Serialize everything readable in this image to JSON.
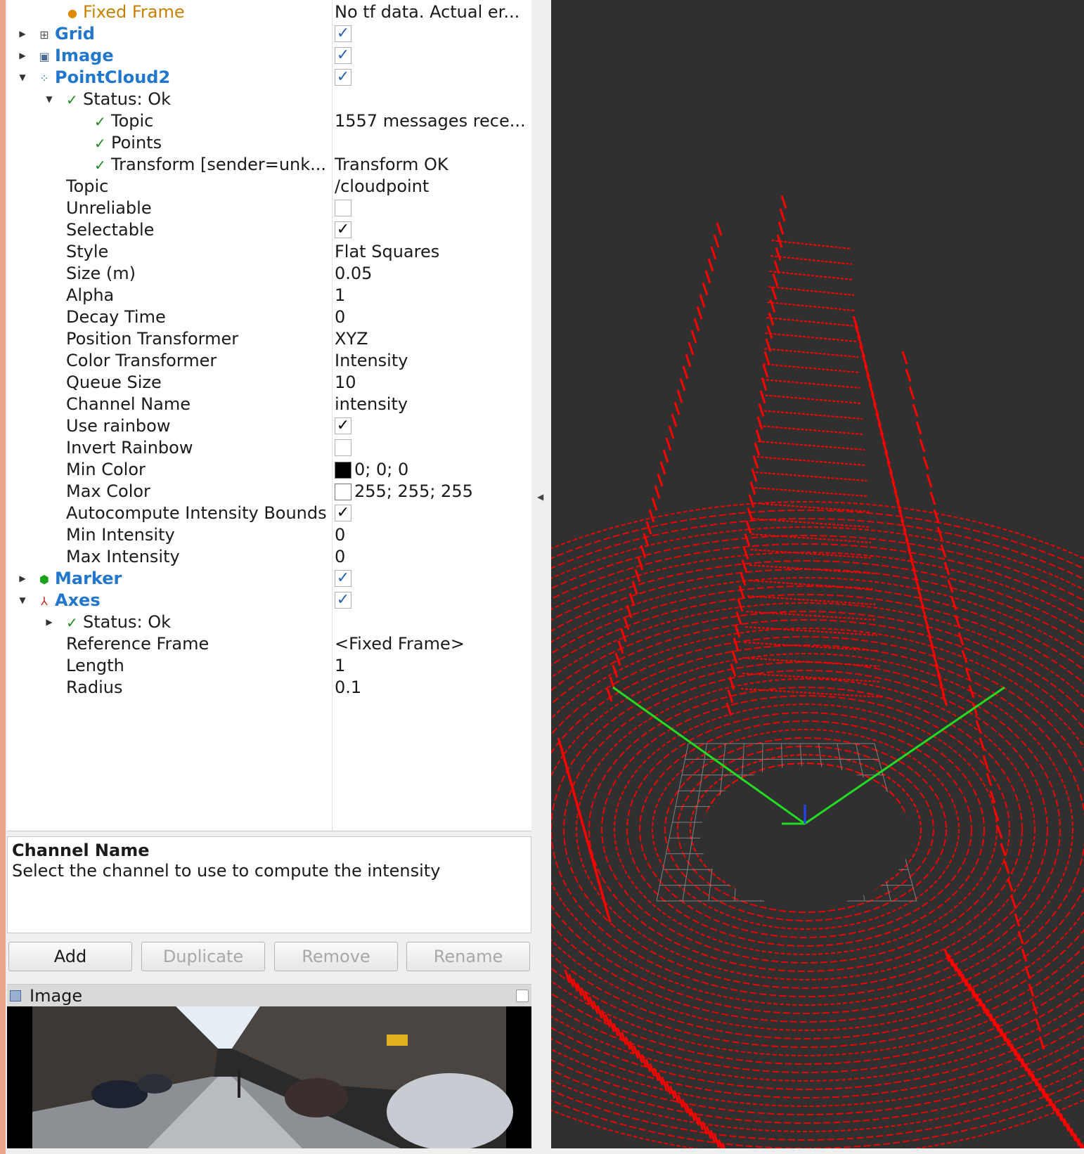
{
  "displays": {
    "fixed_frame": {
      "label": "Fixed Frame",
      "value": "No tf data.  Actual er..."
    },
    "grid": {
      "label": "Grid"
    },
    "image": {
      "label": "Image"
    },
    "pointcloud": {
      "label": "PointCloud2",
      "status": "Status: Ok",
      "status_topic": {
        "label": "Topic",
        "value": "1557 messages rece..."
      },
      "status_points": {
        "label": "Points"
      },
      "status_transform": {
        "label": "Transform [sender=unk...",
        "value": "Transform OK"
      },
      "props": [
        {
          "label": "Topic",
          "value": "/cloudpoint"
        },
        {
          "label": "Unreliable"
        },
        {
          "label": "Selectable"
        },
        {
          "label": "Style",
          "value": "Flat Squares"
        },
        {
          "label": "Size (m)",
          "value": "0.05"
        },
        {
          "label": "Alpha",
          "value": "1"
        },
        {
          "label": "Decay Time",
          "value": "0"
        },
        {
          "label": "Position Transformer",
          "value": "XYZ"
        },
        {
          "label": "Color Transformer",
          "value": "Intensity"
        },
        {
          "label": "Queue Size",
          "value": "10"
        },
        {
          "label": "Channel Name",
          "value": "intensity"
        },
        {
          "label": "Use rainbow"
        },
        {
          "label": "Invert Rainbow"
        },
        {
          "label": "Min Color",
          "value": "0; 0; 0"
        },
        {
          "label": "Max Color",
          "value": "255; 255; 255"
        },
        {
          "label": "Autocompute Intensity Bounds"
        },
        {
          "label": "Min Intensity",
          "value": "0"
        },
        {
          "label": "Max Intensity",
          "value": "0"
        }
      ]
    },
    "marker": {
      "label": "Marker"
    },
    "axes": {
      "label": "Axes",
      "status": "Status: Ok",
      "props": [
        {
          "label": "Reference Frame",
          "value": "<Fixed Frame>"
        },
        {
          "label": "Length",
          "value": "1"
        },
        {
          "label": "Radius",
          "value": "0.1"
        }
      ]
    }
  },
  "checkboxes": {
    "grid": true,
    "image": true,
    "pointcloud": true,
    "unreliable": false,
    "selectable": true,
    "use_rainbow": true,
    "invert_rainbow": false,
    "autocompute": true,
    "marker": true,
    "axes": true
  },
  "description": {
    "title": "Channel Name",
    "text": "Select the channel to use to compute the intensity"
  },
  "buttons": {
    "add": "Add",
    "duplicate": "Duplicate",
    "remove": "Remove",
    "rename": "Rename"
  },
  "image_panel": {
    "title": "Image"
  },
  "colors": {
    "link_blue": "#2277cc",
    "warn_orange": "#c88000",
    "ok_green": "#1a8a1a",
    "cloud_red": "#ff0000",
    "axis_green": "#22dd22",
    "viewport_bg": "#303030"
  },
  "icons": {
    "fixed_frame": "warning-icon",
    "grid": "grid-icon",
    "image": "image-icon",
    "pointcloud": "pointcloud-icon",
    "marker": "marker-cube-icon",
    "axes": "axes-icon"
  }
}
